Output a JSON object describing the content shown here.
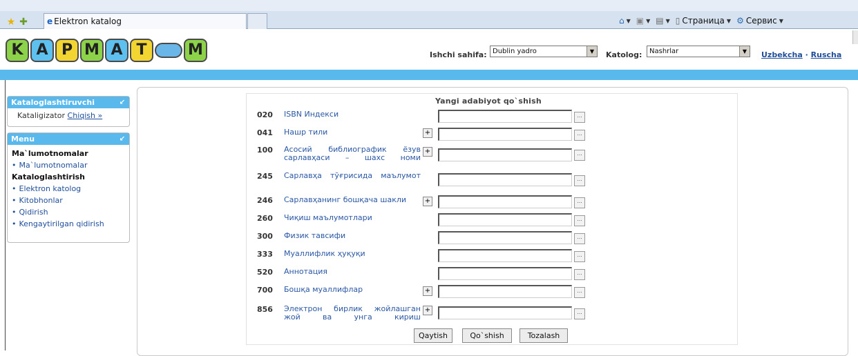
{
  "browser": {
    "tab_title": "Elektron katalog",
    "commands": {
      "page": "Страница",
      "tools": "Сервис"
    }
  },
  "header": {
    "logo_letters": [
      "K",
      "A",
      "P",
      "M",
      "A",
      "T",
      "M"
    ],
    "logo_colors": [
      "#8dd34a",
      "#5ec0ee",
      "#f2d531",
      "#8dd34a",
      "#5ec0ee",
      "#f2d531",
      "#8dd34a"
    ],
    "workspace_label": "Ishchi sahifa:",
    "workspace_value": "Dublin yadro",
    "catalog_label": "Katolog:",
    "catalog_value": "Nashrlar",
    "lang_uz": "Uzbekcha",
    "lang_sep": "·",
    "lang_ru": "Ruscha"
  },
  "sidebar": {
    "user_box": {
      "title": "Kataloglashtiruvchi",
      "user": "Kataligizator",
      "logout": "Chiqish »"
    },
    "menu_box": {
      "title": "Menu",
      "section1": "Ma`lumotnomalar",
      "item1": "Ma`lumotnomalar",
      "section2": "Kataloglashtirish",
      "item2": "Elektron katolog",
      "item3": "Kitobhonlar",
      "item4": "Qidirish",
      "item5": "Kengaytirilgan qidirish"
    }
  },
  "form": {
    "title": "Yangi adabiyot qo`shish",
    "rows": [
      {
        "code": "020",
        "label": "ISBN Индекси",
        "plus": false
      },
      {
        "code": "041",
        "label": "Нашр тили",
        "plus": true
      },
      {
        "code": "100",
        "label": "Асосий библиографик ёзув сарлавҳаси – шахс номи",
        "plus": true
      },
      {
        "code": "245",
        "label": "Сарлавҳа тўғрисида маълумот",
        "plus": false
      },
      {
        "code": "246",
        "label": "Сарлавҳанинг бошқача шакли",
        "plus": true
      },
      {
        "code": "260",
        "label": "Чиқиш маълумотлари",
        "plus": false
      },
      {
        "code": "300",
        "label": "Физик тавсифи",
        "plus": false
      },
      {
        "code": "333",
        "label": "Муаллифлик ҳуқуқи",
        "plus": false
      },
      {
        "code": "520",
        "label": "Аннотация",
        "plus": false
      },
      {
        "code": "700",
        "label": "Бошқа муаллифлар",
        "plus": true
      },
      {
        "code": "856",
        "label": "Электрон бирлик жойлашган жой ва унга кириш",
        "plus": true
      }
    ],
    "plus_label": "+",
    "dots_label": "...",
    "buttons": {
      "back": "Qaytish",
      "add": "Qo`shish",
      "clear": "Tozalash"
    }
  }
}
